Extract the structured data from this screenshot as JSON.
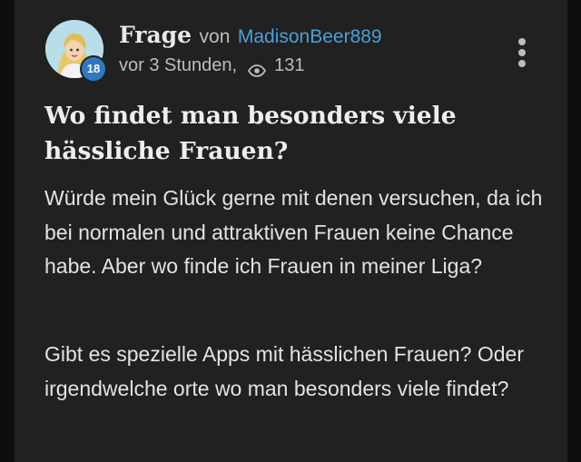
{
  "question": {
    "type_label": "Frage",
    "by_label": "von",
    "author": "MadisonBeer889",
    "author_level": "18",
    "time": "vor 3 Stunden,",
    "views": "131",
    "title": "Wo findet man besonders viele hässliche Frauen?",
    "body": [
      "Würde mein Glück gerne mit denen versuchen, da ich bei normalen und attraktiven Frauen keine Chance habe. Aber wo finde ich Frauen in meiner Liga?",
      "Gibt es spezielle Apps mit hässlichen Frauen? Oder irgendwelche orte wo man besonders viele findet?"
    ]
  },
  "icons": {
    "views": "eye-icon",
    "menu": "more-vertical-icon"
  },
  "colors": {
    "background": "#0e0e0e",
    "card": "#212121",
    "author_link": "#4b9fd9",
    "level_badge": "#2f78c4"
  }
}
